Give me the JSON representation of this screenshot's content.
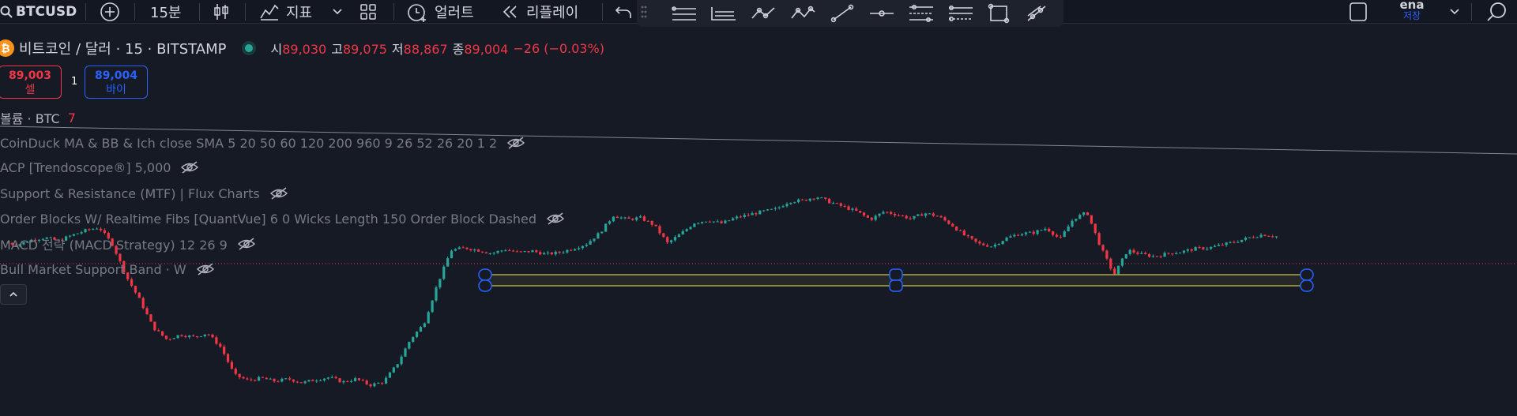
{
  "toolbar": {
    "symbol": "BTCUSD",
    "interval": "15분",
    "indicators_label": "지표",
    "alert_label": "얼러트",
    "replay_label": "리플레이",
    "user_name": "ena",
    "save_label": "저장"
  },
  "legend": {
    "title": "비트코인 / 달러 · 15 · BITSTAMP",
    "open_label": "시",
    "open": "89,030",
    "high_label": "고",
    "high": "89,075",
    "low_label": "저",
    "low": "88,867",
    "close_label": "종",
    "close": "89,004",
    "change": "−26 (−0.03%)"
  },
  "trade": {
    "sell_price": "89,003",
    "sell_label": "셀",
    "quantity": "1",
    "buy_price": "89,004",
    "buy_label": "바이"
  },
  "indicators": {
    "volume_label": "볼륨 · BTC",
    "volume_value": "7",
    "items": [
      "CoinDuck MA & BB & Ich close SMA 5 20 50 60 120 200 960 9 26 52 26 20 1 2",
      "ACP [Trendoscope®] 5,000",
      "Support & Resistance (MTF) | Flux Charts",
      "Order Blocks W/ Realtime Fibs [QuantVue] 6 0 Wicks Length 150 Order Block Dashed",
      "MACD 전략 (MACD Strategy) 12 26 9",
      "Bull Market Support Band · W"
    ]
  },
  "colors": {
    "up": "#26a69a",
    "down": "#f23645",
    "background": "#161a25",
    "accent": "#2962ff",
    "rectangle": "#d4c84a"
  },
  "chart_data": {
    "type": "candlestick",
    "symbol": "BTCUSD",
    "interval": "15",
    "last_close": 89004,
    "close_series": [
      88930,
      88900,
      88960,
      88990,
      88950,
      89020,
      89080,
      89120,
      88900,
      88500,
      88200,
      87850,
      87700,
      87760,
      87730,
      87780,
      87600,
      87250,
      87180,
      87210,
      87170,
      87200,
      87150,
      87190,
      87220,
      87160,
      87200,
      87120,
      87160,
      87380,
      87700,
      87900,
      88400,
      88830,
      88860,
      88830,
      88790,
      88840,
      88800,
      88820,
      88780,
      88800,
      88850,
      88910,
      89050,
      89270,
      89220,
      89240,
      89150,
      88920,
      89040,
      89180,
      89210,
      89170,
      89240,
      89280,
      89320,
      89350,
      89450,
      89460,
      89510,
      89440,
      89380,
      89320,
      89220,
      89320,
      89280,
      89230,
      89300,
      89260,
      89150,
      89010,
      88910,
      88880,
      88980,
      89040,
      89050,
      89110,
      88970,
      89230,
      89310,
      88870,
      88520,
      88830,
      88780,
      88750,
      88790,
      88810,
      88850,
      88860,
      88900,
      88940,
      88990,
      89030,
      89004
    ]
  }
}
